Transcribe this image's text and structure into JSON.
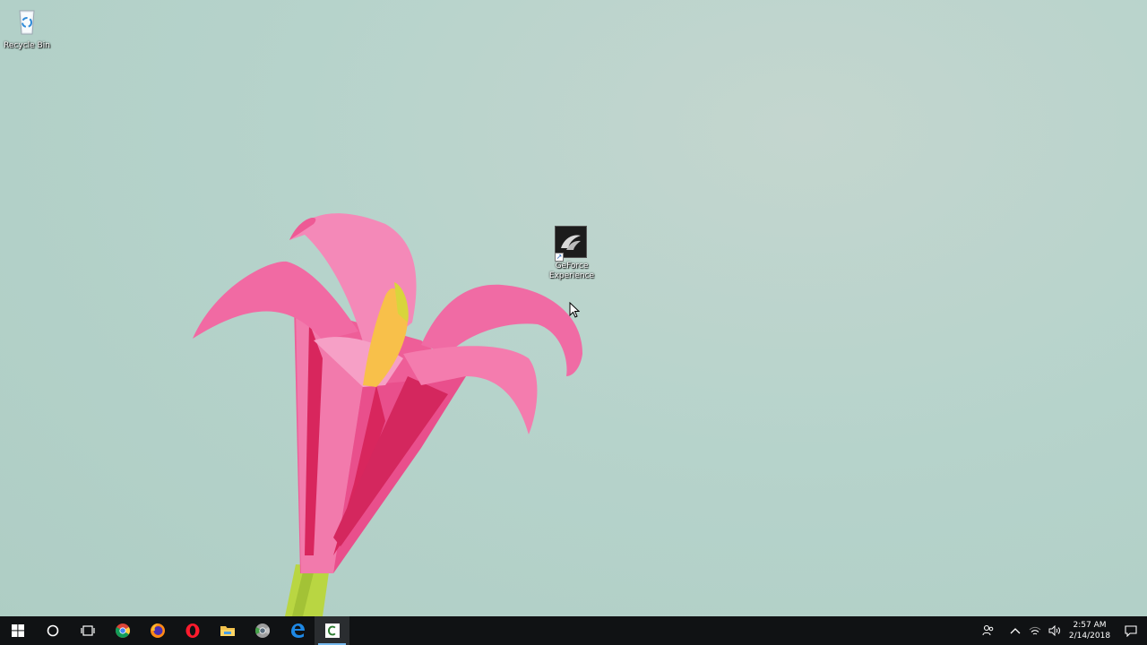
{
  "desktop": {
    "icons": [
      {
        "label": "Recycle Bin",
        "icon": "recycle-bin-icon"
      },
      {
        "label": "GeForce Experience",
        "icon": "geforce-experience-icon"
      }
    ],
    "wallpaper": "origami-pink-lily"
  },
  "taskbar": {
    "apps": [
      {
        "name": "start",
        "icon": "windows-logo-icon"
      },
      {
        "name": "cortana",
        "icon": "cortana-circle-icon"
      },
      {
        "name": "task-view",
        "icon": "task-view-icon"
      },
      {
        "name": "chrome",
        "icon": "chrome-icon"
      },
      {
        "name": "firefox",
        "icon": "firefox-icon"
      },
      {
        "name": "opera",
        "icon": "opera-icon"
      },
      {
        "name": "file-explorer",
        "icon": "folder-icon"
      },
      {
        "name": "chrome-canary",
        "icon": "chrome-canary-icon"
      },
      {
        "name": "edge",
        "icon": "edge-icon"
      },
      {
        "name": "camtasia",
        "icon": "camtasia-icon",
        "active": true
      }
    ],
    "tray": {
      "time": "2:57 AM",
      "date": "2/14/2018"
    }
  },
  "colors": {
    "taskbar": "#101214",
    "accent": "#76b9ed",
    "wallpaper": "#b6d3cb",
    "petal": "#f0629c"
  }
}
